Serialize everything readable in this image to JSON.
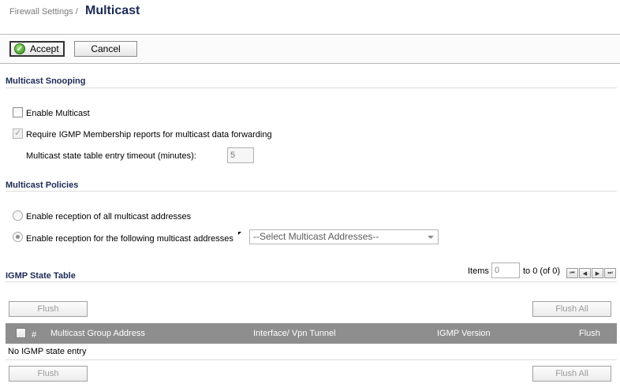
{
  "header": {
    "breadcrumb": "Firewall Settings /",
    "title": "Multicast"
  },
  "toolbar": {
    "accept_label": "Accept",
    "cancel_label": "Cancel"
  },
  "snooping": {
    "title": "Multicast Snooping",
    "enable_multicast_label": "Enable Multicast",
    "enable_multicast_checked": false,
    "require_igmp_label": "Require IGMP Membership reports for multicast data forwarding",
    "require_igmp_checked": true,
    "timeout_label": "Multicast state table entry timeout (minutes):",
    "timeout_value": "5"
  },
  "policies": {
    "title": "Multicast Policies",
    "all_addresses_label": "Enable reception of all multicast addresses",
    "following_addresses_label": "Enable reception for the following multicast addresses",
    "address_select_value": "--Select Multicast Addresses--"
  },
  "igmp": {
    "title": "IGMP State Table",
    "items_label": "Items",
    "items_value": "0",
    "range_text": "to 0 (of 0)",
    "pager": [
      "first-page",
      "prev-page",
      "next-page",
      "last-page"
    ],
    "flush_label": "Flush",
    "flush_all_label": "Flush All",
    "columns": {
      "number": "#",
      "group_address": "Multicast Group Address",
      "interface": "Interface/ Vpn Tunnel",
      "igmp_version": "IGMP Version",
      "flush": "Flush"
    },
    "empty_message": "No IGMP state entry"
  }
}
